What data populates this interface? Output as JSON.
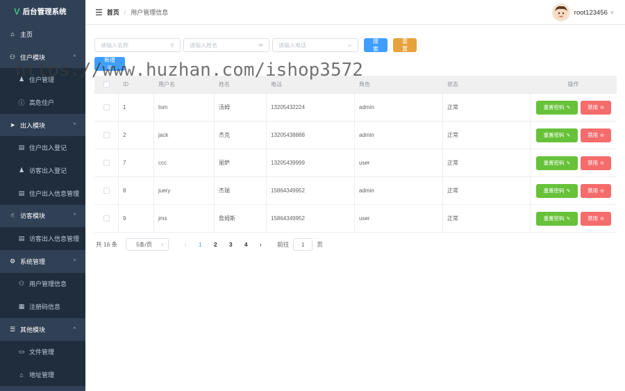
{
  "brand": {
    "logo": "V",
    "title": "后台管理系统"
  },
  "sidebar": {
    "items": [
      {
        "label": "主页",
        "icon": "home-icon",
        "glyph": "⌂",
        "level": "top",
        "caret": ""
      },
      {
        "label": "住户模块",
        "icon": "user-icon",
        "glyph": "⚇",
        "level": "top",
        "caret": "^"
      },
      {
        "label": "住户管理",
        "icon": "person-icon",
        "glyph": "♟",
        "level": "sub",
        "caret": ""
      },
      {
        "label": "高危住户",
        "icon": "info-icon",
        "glyph": "ⓘ",
        "level": "sub",
        "caret": ""
      },
      {
        "label": "出入模块",
        "icon": "send-icon",
        "glyph": "➤",
        "level": "top",
        "caret": "^"
      },
      {
        "label": "住户出入登记",
        "icon": "document-icon",
        "glyph": "▤",
        "level": "sub",
        "caret": ""
      },
      {
        "label": "访客出入登记",
        "icon": "stamp-icon",
        "glyph": "♟",
        "level": "sub",
        "caret": ""
      },
      {
        "label": "住户出入信息管理",
        "icon": "document-icon",
        "glyph": "▤",
        "level": "sub",
        "caret": ""
      },
      {
        "label": "访客模块",
        "icon": "thumb-icon",
        "glyph": "☝",
        "level": "top",
        "caret": "^"
      },
      {
        "label": "访客出入信息管理",
        "icon": "document-icon",
        "glyph": "▤",
        "level": "sub",
        "caret": ""
      },
      {
        "label": "系统管理",
        "icon": "gear-icon",
        "glyph": "⚙",
        "level": "top",
        "caret": "^"
      },
      {
        "label": "用户管理信息",
        "icon": "user-icon",
        "glyph": "⚇",
        "level": "sub",
        "caret": ""
      },
      {
        "label": "注册码信息",
        "icon": "grid-icon",
        "glyph": "▦",
        "level": "sub",
        "caret": ""
      },
      {
        "label": "其他模块",
        "icon": "menu-icon",
        "glyph": "☰",
        "level": "top",
        "caret": "^"
      },
      {
        "label": "文件管理",
        "icon": "folder-icon",
        "glyph": "▭",
        "level": "sub",
        "caret": ""
      },
      {
        "label": "地址管理",
        "icon": "house-icon",
        "glyph": "⌂",
        "level": "sub",
        "caret": ""
      }
    ]
  },
  "header": {
    "home": "首页",
    "separator": "/",
    "current": "用户管理信息",
    "username": "root123456"
  },
  "search": {
    "name_placeholder": "请输入名称",
    "realname_placeholder": "请输入姓名",
    "phone_placeholder": "请输入电话",
    "search_label": "搜索",
    "reset_label": "重置"
  },
  "add_label": "新增 ⊕",
  "watermark": "https://www.huzhan.com/ishop3572",
  "table": {
    "headers": [
      "ID",
      "用户名",
      "姓名",
      "电话",
      "角色",
      "状态",
      "操作"
    ],
    "rows": [
      {
        "id": "1",
        "username": "tom",
        "name": "汤姆",
        "phone": "13205432224",
        "role": "admin",
        "status": "正常"
      },
      {
        "id": "2",
        "username": "jack",
        "name": "杰克",
        "phone": "13205438888",
        "role": "admin",
        "status": "正常"
      },
      {
        "id": "7",
        "username": "ccc",
        "name": "丽萨",
        "phone": "13205439999",
        "role": "user",
        "status": "正常"
      },
      {
        "id": "8",
        "username": "juery",
        "name": "杰瑞",
        "phone": "15864349952",
        "role": "admin",
        "status": "正常"
      },
      {
        "id": "9",
        "username": "jms",
        "name": "詹姆斯",
        "phone": "15864349952",
        "role": "user",
        "status": "正常"
      }
    ],
    "reset_pwd_label": "重置密码",
    "disable_label": "禁用"
  },
  "pagination": {
    "total": "共 16 条",
    "page_size": "5条/页",
    "pages": [
      "1",
      "2",
      "3",
      "4"
    ],
    "current": "1",
    "goto_label": "前往",
    "goto_value": "1",
    "page_suffix": "页"
  },
  "colors": {
    "sidebar_bg": "#304156",
    "submenu_bg": "#1f2d3d",
    "primary": "#409eff",
    "success": "#67c23a",
    "warning": "#e6a23c",
    "danger": "#f56c6c"
  }
}
